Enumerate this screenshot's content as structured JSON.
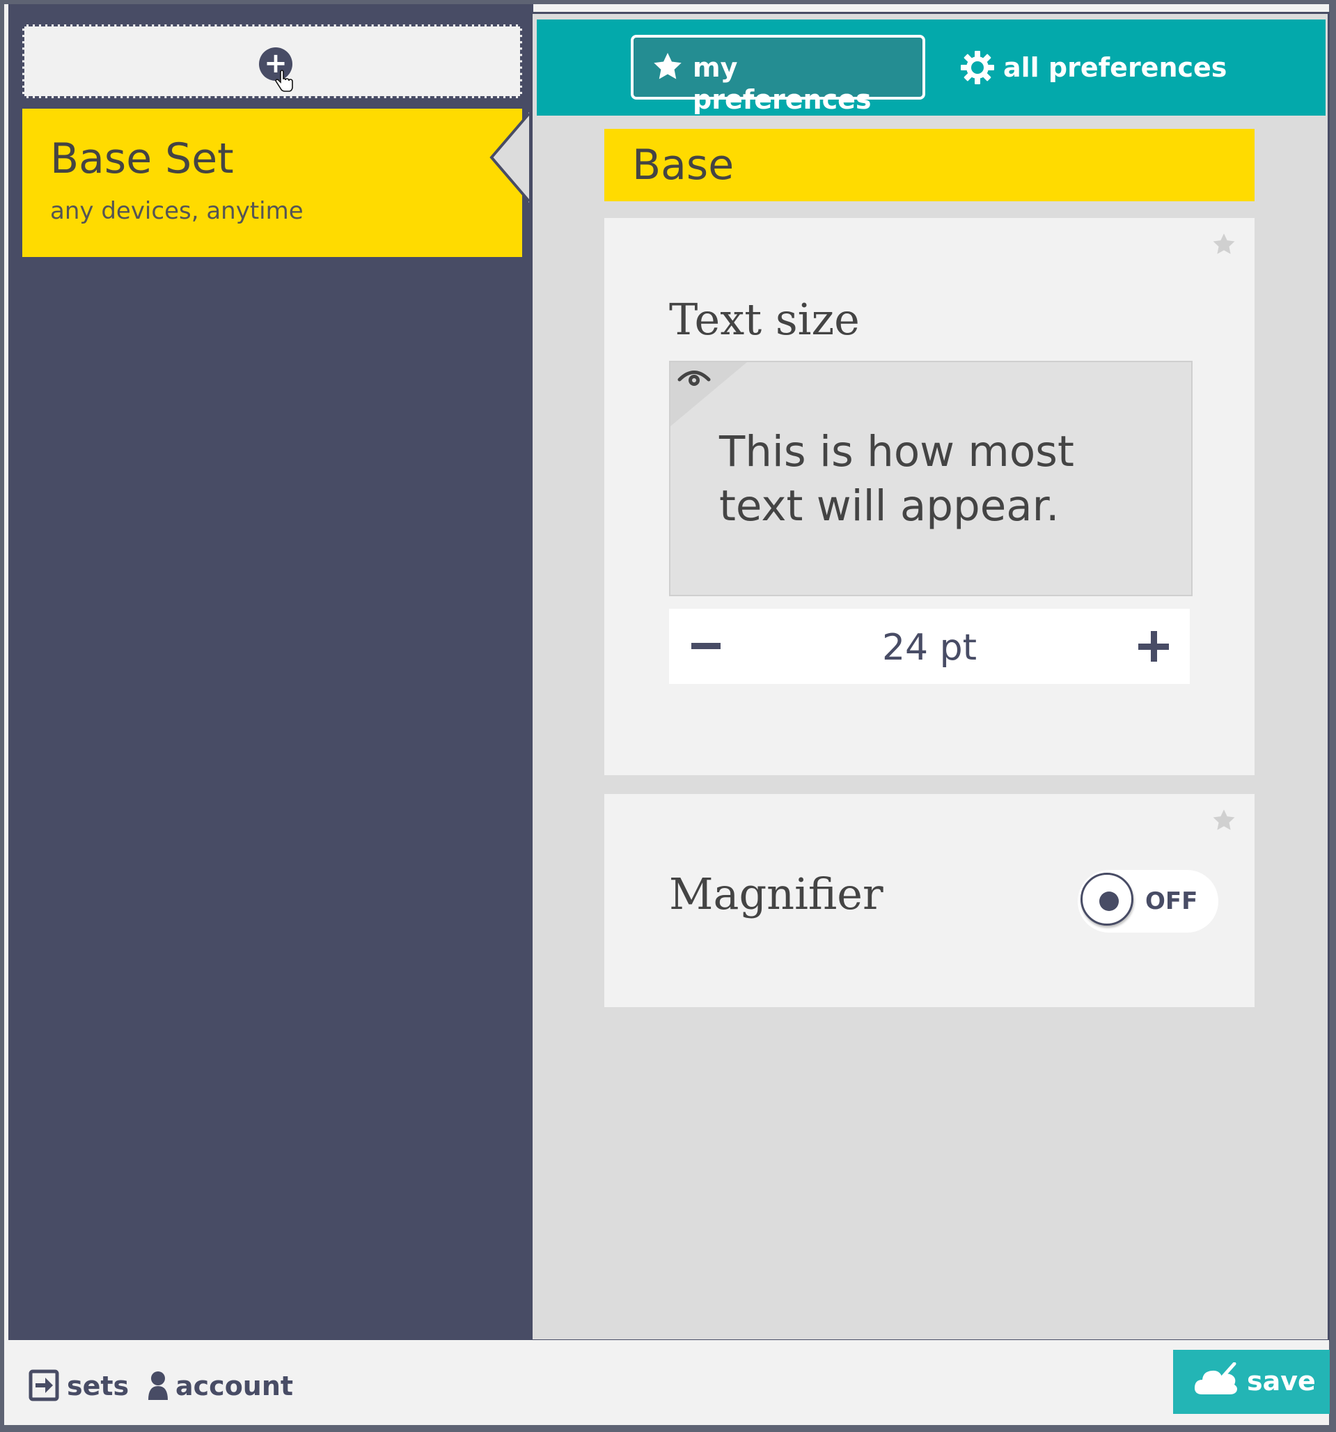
{
  "sidebar": {
    "add_set_icon": "add-circle-icon",
    "set": {
      "name": "Base Set",
      "subtitle": "any devices, anytime"
    }
  },
  "topbar": {
    "tabs": [
      {
        "label": "my preferences",
        "icon": "star-icon",
        "selected": true
      },
      {
        "label": "all preferences",
        "icon": "gear-icon",
        "selected": false
      }
    ]
  },
  "main": {
    "group_title": "Base",
    "preferences": {
      "text_size": {
        "title": "Text size",
        "preview_text": "This is how most text will appear.",
        "value": "24 pt"
      },
      "magnifier": {
        "title": "Magnifier",
        "state": "OFF"
      }
    }
  },
  "bottombar": {
    "sets_label": "sets",
    "account_label": "account",
    "save_label": "save"
  },
  "colors": {
    "sidebar_bg": "#484c65",
    "accent_teal": "#03a9ab",
    "highlight_yellow": "#ffdb00",
    "save_teal": "#23b5b5"
  }
}
